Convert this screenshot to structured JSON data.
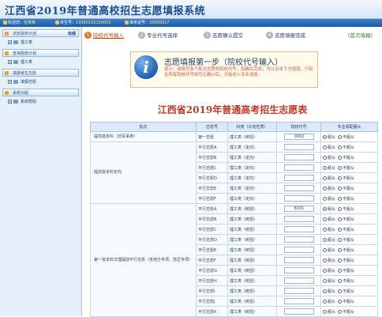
{
  "app": {
    "title": "江西省2019年普通高校招生志愿填报系统"
  },
  "infobar": {
    "welcome_label": "欢迎您：",
    "welcome_name": "张某某",
    "exam_label": "考生号：",
    "exam_number": "19360102150001",
    "id_label": "准考证号：",
    "id_number": "20000017"
  },
  "sidebar": {
    "sections": [
      {
        "title": "浏览院校计划",
        "action": "收缩",
        "items": [
          {
            "label": "理工类"
          }
        ]
      },
      {
        "title": "查询院校计划",
        "items": [
          {
            "label": "理工类"
          }
        ]
      },
      {
        "title": "填报考生志愿",
        "items": [
          {
            "label": "填报志愿"
          }
        ]
      },
      {
        "title": "系统功能",
        "items": [
          {
            "label": "系统帮助"
          }
        ]
      }
    ]
  },
  "steps": [
    {
      "num": "1",
      "label": "院校代号输入"
    },
    {
      "num": "2",
      "label": "专业代号选择"
    },
    {
      "num": "3",
      "label": "志愿确认提交"
    },
    {
      "num": "4",
      "label": "志愿填报完成"
    }
  ],
  "first_fill": "(首次填报)",
  "notice": {
    "icon_letter": "i",
    "title": "志愿填报第一步（院校代号输入）",
    "text": "提示：请填写各个批次志愿的院校代号，如确实完成，可以点击下方按钮，只有在所有院校代号填写正确以后，才能进入专业选择。"
  },
  "page_heading": "江西省2019年普通高考招生志愿表",
  "table": {
    "headers": [
      "批次",
      "志愿号",
      "科类（计划性质）",
      "院校代号",
      "专业调配服从"
    ],
    "adjust_yes": "服从",
    "adjust_no": "不服从",
    "sections": [
      {
        "name": "提前批本科（非军事类）",
        "rows": [
          {
            "vol": "第一志愿",
            "subject": "理工类（统招）",
            "code": "0002",
            "adjust": "yes"
          }
        ]
      },
      {
        "name": "提前批本科定向",
        "rows": [
          {
            "vol": "平行志愿A",
            "subject": "理工类（定向）",
            "code": "",
            "adjust": ""
          },
          {
            "vol": "平行志愿B",
            "subject": "理工类（定向）",
            "code": "",
            "adjust": ""
          },
          {
            "vol": "平行志愿C",
            "subject": "理工类（定向）",
            "code": "",
            "adjust": ""
          },
          {
            "vol": "平行志愿D",
            "subject": "理工类（定向）",
            "code": "",
            "adjust": ""
          },
          {
            "vol": "平行志愿E",
            "subject": "理工类（定向）",
            "code": "",
            "adjust": ""
          },
          {
            "vol": "平行志愿F",
            "subject": "理工类（定向）",
            "code": "",
            "adjust": ""
          }
        ]
      },
      {
        "name": "第一批本科文理提前平行志愿（含地方专项、苏区专项）",
        "rows": [
          {
            "vol": "平行志愿A",
            "subject": "理工类（统招）",
            "code": "8101",
            "adjust": "yes"
          },
          {
            "vol": "平行志愿B",
            "subject": "理工类（统招）",
            "code": "",
            "adjust": ""
          },
          {
            "vol": "平行志愿C",
            "subject": "理工类（统招）",
            "code": "",
            "adjust": ""
          },
          {
            "vol": "平行志愿D",
            "subject": "理工类（统招）",
            "code": "",
            "adjust": ""
          },
          {
            "vol": "平行志愿E",
            "subject": "理工类（统招）",
            "code": "",
            "adjust": ""
          },
          {
            "vol": "平行志愿F",
            "subject": "理工类（统招）",
            "code": "",
            "adjust": ""
          },
          {
            "vol": "平行志愿G",
            "subject": "理工类（统招）",
            "code": "",
            "adjust": ""
          },
          {
            "vol": "平行志愿H",
            "subject": "理工类（统招）",
            "code": "",
            "adjust": ""
          },
          {
            "vol": "平行志愿I",
            "subject": "理工类（统招）",
            "code": "",
            "adjust": ""
          },
          {
            "vol": "平行志愿J",
            "subject": "理工类（统招）",
            "code": "",
            "adjust": ""
          },
          {
            "vol": "平行志愿K",
            "subject": "理工类（统招）",
            "code": "",
            "adjust": ""
          }
        ]
      }
    ]
  },
  "colors": {
    "brand_blue": "#1a4f93",
    "heading_red": "#c0392b",
    "active_step": "#e07a1f"
  }
}
